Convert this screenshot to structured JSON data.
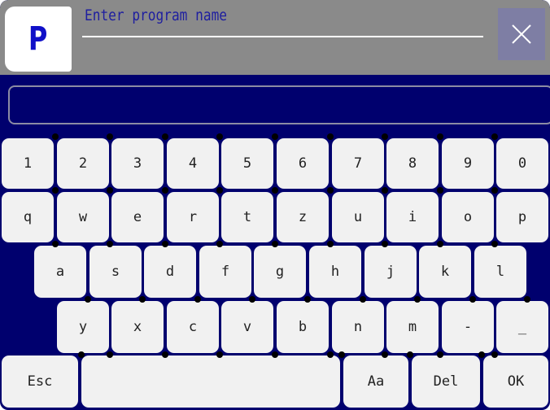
{
  "header": {
    "logo_letter": "P",
    "prompt": "Enter program name",
    "close_icon": "close-x-icon"
  },
  "input": {
    "value": ""
  },
  "keyboard": {
    "row1": [
      "1",
      "2",
      "3",
      "4",
      "5",
      "6",
      "7",
      "8",
      "9",
      "0"
    ],
    "row2": [
      "q",
      "w",
      "e",
      "r",
      "t",
      "z",
      "u",
      "i",
      "o",
      "p"
    ],
    "row3": [
      "a",
      "s",
      "d",
      "f",
      "g",
      "h",
      "j",
      "k",
      "l"
    ],
    "row4": [
      "y",
      "x",
      "c",
      "v",
      "b",
      "n",
      "m",
      "-",
      "_"
    ],
    "row5": {
      "esc": "Esc",
      "space": "",
      "case": "Aa",
      "del": "Del",
      "ok": "OK"
    }
  },
  "colors": {
    "background": "#00006e",
    "header": "#8a8a8a",
    "key": "#f1f1f1",
    "logo_text": "#1010c8",
    "prompt_text": "#1e1ea0",
    "close_button": "#7e7ea4"
  }
}
